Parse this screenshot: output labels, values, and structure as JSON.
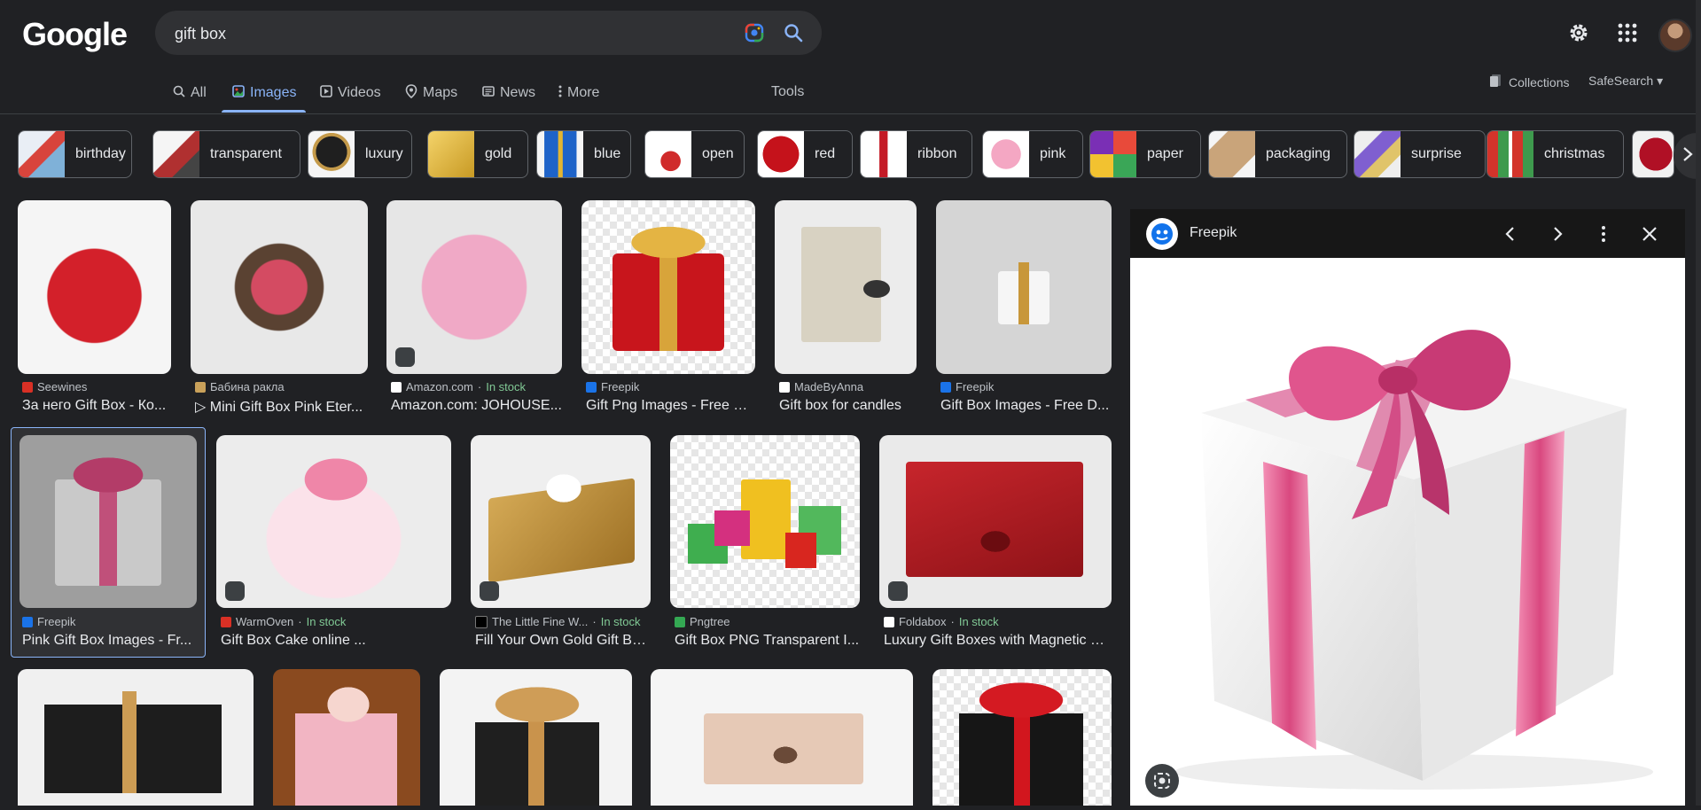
{
  "header": {
    "logo": "Google",
    "search_value": "gift box",
    "icons": [
      "camera-lens-icon",
      "search-icon",
      "gear-icon",
      "apps-grid-icon"
    ]
  },
  "tabs": [
    {
      "label": "All",
      "icon": "search-icon"
    },
    {
      "label": "Images",
      "icon": "image-icon",
      "active": true
    },
    {
      "label": "Videos",
      "icon": "play-icon"
    },
    {
      "label": "Maps",
      "icon": "pin-icon"
    },
    {
      "label": "News",
      "icon": "news-icon"
    },
    {
      "label": "More",
      "icon": "dots-vertical-icon"
    }
  ],
  "tools": "Tools",
  "collections": "Collections",
  "safesearch": "SafeSearch",
  "chips": [
    "birthday",
    "transparent",
    "luxury",
    "gold",
    "blue",
    "open",
    "red",
    "ribbon",
    "pink",
    "paper",
    "packaging",
    "surprise",
    "christmas"
  ],
  "results": {
    "row1": [
      {
        "source": "Seewines",
        "stock": "",
        "title": "За него Gift Box - Ко..."
      },
      {
        "source": "Бабина ракла",
        "stock": "",
        "title": "▷ Mini Gift Box Pink Eter..."
      },
      {
        "source": "Amazon.com",
        "stock": "In stock",
        "title": "Amazon.com: JOHOUSE..."
      },
      {
        "source": "Freepik",
        "stock": "",
        "title": "Gift Png Images - Free D..."
      },
      {
        "source": "MadeByAnna",
        "stock": "",
        "title": "Gift box for candles"
      },
      {
        "source": "Freepik",
        "stock": "",
        "title": "Gift Box Images - Free D..."
      }
    ],
    "row2": [
      {
        "source": "Freepik",
        "stock": "",
        "title": "Pink Gift Box Images - Fr..."
      },
      {
        "source": "WarmOven",
        "stock": "In stock",
        "title": "Gift Box Cake online ..."
      },
      {
        "source": "The Little Fine W...",
        "stock": "In stock",
        "title": "Fill Your Own Gold Gift Bo..."
      },
      {
        "source": "Pngtree",
        "stock": "",
        "title": "Gift Box PNG Transparent I..."
      },
      {
        "source": "Foldabox",
        "stock": "In stock",
        "title": "Luxury Gift Boxes with Magnetic Cl..."
      }
    ]
  },
  "panel": {
    "source": "Freepik"
  },
  "colors": {
    "bg": "#202124",
    "accent": "#8ab4f8",
    "stock": "#81c995"
  }
}
